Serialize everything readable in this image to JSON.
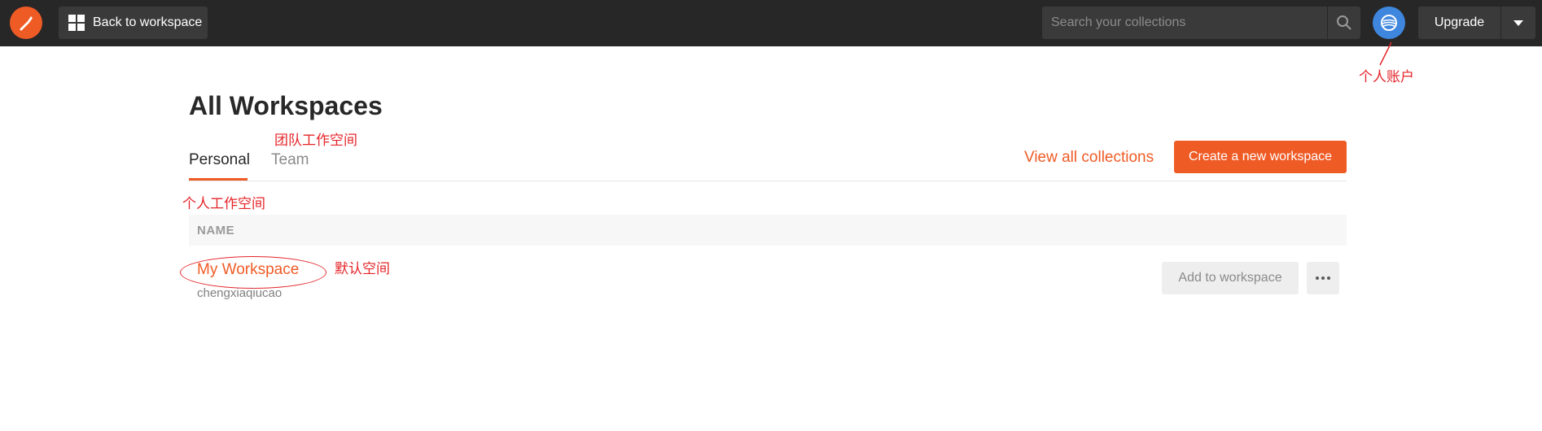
{
  "header": {
    "back_label": "Back to workspace",
    "search_placeholder": "Search your collections",
    "upgrade_label": "Upgrade"
  },
  "page": {
    "title": "All Workspaces",
    "tabs": [
      {
        "label": "Personal",
        "active": true
      },
      {
        "label": "Team",
        "active": false
      }
    ],
    "view_all_label": "View all collections",
    "create_label": "Create a new workspace"
  },
  "table": {
    "column_name": "NAME",
    "rows": [
      {
        "name": "My Workspace",
        "owner": "chengxiaqiucao",
        "add_label": "Add to workspace"
      }
    ]
  },
  "annotations": {
    "account": "个人账户",
    "team": "团队工作空间",
    "personal": "个人工作空间",
    "default": "默认空间"
  },
  "colors": {
    "brand": "#ef5b25",
    "topbar": "#272727",
    "annotation": "#e5252a",
    "avatar": "#3f87de"
  },
  "icons": [
    "postman-logo-icon",
    "grid-icon",
    "search-icon",
    "avatar-icon",
    "chevron-down-icon",
    "more-icon"
  ]
}
